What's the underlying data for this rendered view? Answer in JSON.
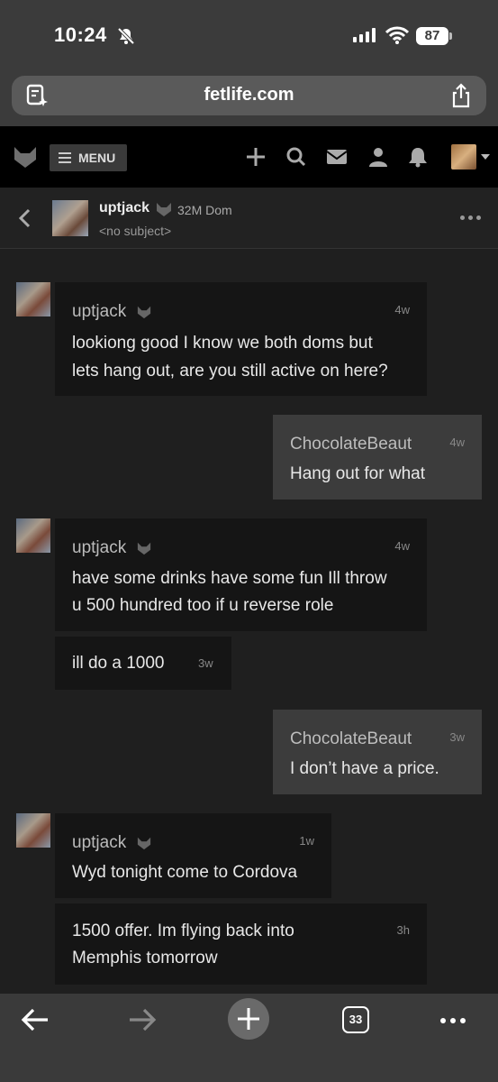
{
  "status_bar": {
    "time": "10:24",
    "battery": "87"
  },
  "browser": {
    "url": "fetlife.com",
    "tab_count": "33"
  },
  "site_nav": {
    "menu_label": "MENU"
  },
  "conversation": {
    "username": "uptjack",
    "user_meta": "32M Dom",
    "subject": "<no subject>"
  },
  "messages": [
    {
      "sender": "uptjack",
      "time": "4w",
      "lines": [
        "lookiong good I know we both doms but",
        "lets hang out, are you still active on here?"
      ]
    },
    {
      "sender": "ChocolateBeaut",
      "time": "4w",
      "lines": [
        "Hang out for what"
      ]
    },
    {
      "sender": "uptjack",
      "time": "4w",
      "lines": [
        "have some drinks have some fun Ill throw",
        "u 500 hundred too if u reverse role"
      ]
    },
    {
      "time": "3w",
      "lines": [
        "ill do a 1000"
      ]
    },
    {
      "sender": "ChocolateBeaut",
      "time": "3w",
      "lines": [
        "I don’t have a price."
      ]
    },
    {
      "sender": "uptjack",
      "time": "1w",
      "lines": [
        "Wyd tonight come to Cordova"
      ]
    },
    {
      "time": "3h",
      "lines": [
        "1500 offer. Im flying back into",
        "Memphis tomorrow"
      ]
    }
  ],
  "icons": {
    "status": [
      "bell-off-icon",
      "signal-icon",
      "wifi-icon",
      "battery-icon"
    ],
    "nav": [
      "fetlife-logo-icon",
      "plus-icon",
      "search-icon",
      "mail-icon",
      "user-icon",
      "bell-icon"
    ],
    "toolbar": [
      "back-arrow-icon",
      "forward-arrow-icon",
      "new-tab-plus-icon",
      "tabs-icon",
      "more-icon"
    ]
  },
  "colors": {
    "page_bg": "#1f1f1f",
    "their_bubble": "#151515",
    "my_bubble": "#3c3c3c",
    "nav_bg": "#000000"
  }
}
